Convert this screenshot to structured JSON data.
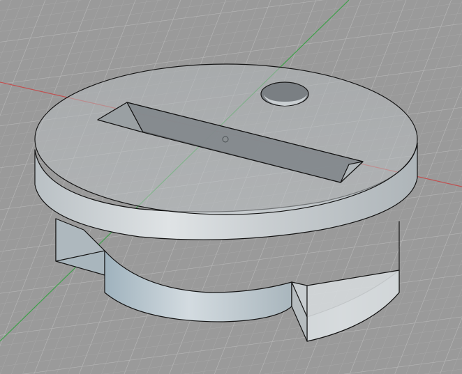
{
  "viewport": {
    "background": "#9a9a9a",
    "grid_minor_color": "#a8a8a8",
    "grid_major_color": "#b8b8b8",
    "x_axis_color": "#c05050",
    "y_axis_color": "#3fa04a",
    "edge_color": "#141414",
    "body_color": "#c4cace",
    "body_shadow_color": "#8e979c",
    "cut_color": "#6f7478"
  },
  "model": {
    "parts": [
      "top-disc",
      "lower-flange",
      "center-hub",
      "slot-cutout",
      "hole-cutout",
      "notch-wedges"
    ]
  }
}
